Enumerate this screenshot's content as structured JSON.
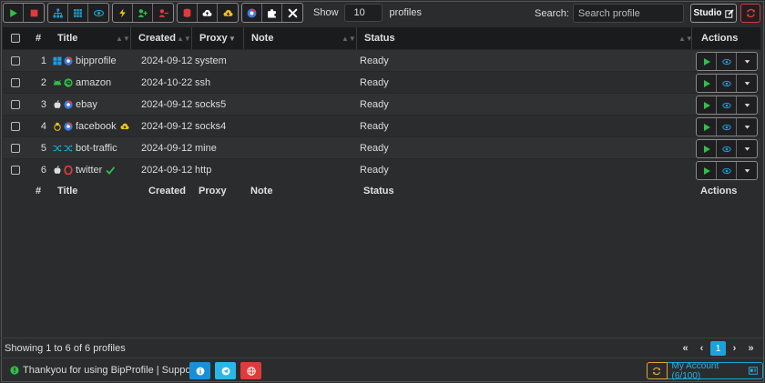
{
  "toolbar": {
    "groups": [
      [
        {
          "icon": "play-icon",
          "color": "#2fbf4a"
        },
        {
          "icon": "stop-icon",
          "color": "#e03a3a"
        }
      ],
      [
        {
          "icon": "sitemap-icon",
          "color": "#1aa3d9"
        },
        {
          "icon": "grid-icon",
          "color": "#1aa3d9"
        },
        {
          "icon": "eye-icon",
          "color": "#1aa3d9"
        }
      ],
      [
        {
          "icon": "bolt-icon",
          "color": "#f0c419"
        },
        {
          "icon": "user-plus-icon",
          "color": "#2fbf4a"
        },
        {
          "icon": "user-minus-icon",
          "color": "#e03a3a"
        }
      ],
      [
        {
          "icon": "database-icon",
          "color": "#e03a3a"
        },
        {
          "icon": "cloud-upload-icon",
          "color": "#ffffff"
        },
        {
          "icon": "cloud-download-icon",
          "color": "#f0c419"
        }
      ],
      [
        {
          "icon": "chrome-icon",
          "color": "#3a7be0"
        },
        {
          "icon": "puzzle-icon",
          "color": "#ffffff"
        },
        {
          "icon": "tools-icon",
          "color": "#ffffff"
        }
      ]
    ],
    "show_label": "Show",
    "show_value": "10",
    "profiles_label": "profiles",
    "search_label": "Search:",
    "search_placeholder": "Search profile",
    "studio_label": "Studio"
  },
  "table": {
    "headers": {
      "num": "#",
      "title": "Title",
      "created": "Created",
      "proxy": "Proxy",
      "note": "Note",
      "status": "Status",
      "actions": "Actions"
    },
    "rows": [
      {
        "num": "1",
        "title": "bipprofile",
        "created": "2024-09-12",
        "proxy": "system",
        "note": "",
        "status": "Ready",
        "os_icon": "windows-icon",
        "browser_icon": "chrome-icon",
        "extra_icon": ""
      },
      {
        "num": "2",
        "title": "amazon",
        "created": "2024-10-22",
        "proxy": "ssh",
        "note": "",
        "status": "Ready",
        "os_icon": "android-icon",
        "browser_icon": "edge-icon",
        "extra_icon": ""
      },
      {
        "num": "3",
        "title": "ebay",
        "created": "2024-09-12",
        "proxy": "socks5",
        "note": "",
        "status": "Ready",
        "os_icon": "apple-icon",
        "browser_icon": "chrome-icon",
        "extra_icon": ""
      },
      {
        "num": "4",
        "title": "facebook",
        "created": "2024-09-12",
        "proxy": "socks4",
        "note": "",
        "status": "Ready",
        "os_icon": "linux-icon",
        "browser_icon": "chrome-icon",
        "extra_icon": "cloud-download-icon"
      },
      {
        "num": "5",
        "title": "bot-traffic",
        "created": "2024-09-12",
        "proxy": "mine",
        "note": "",
        "status": "Ready",
        "os_icon": "random-icon",
        "browser_icon": "random-icon",
        "extra_icon": ""
      },
      {
        "num": "6",
        "title": "twitter",
        "created": "2024-09-12",
        "proxy": "http",
        "note": "",
        "status": "Ready",
        "os_icon": "apple-icon",
        "browser_icon": "opera-icon",
        "extra_icon": "check-icon"
      }
    ]
  },
  "info": {
    "showing": "Showing 1 to 6 of 6 profiles",
    "pager": {
      "first": "«",
      "prev": "‹",
      "current": "1",
      "next": "›",
      "last": "»"
    }
  },
  "footer": {
    "thanks": "Thankyou for using BipProfile | Support",
    "account_label": "My Account (6/100)"
  },
  "colors": {
    "green": "#2fbf4a",
    "red": "#e03a3a",
    "blue": "#1aa3d9",
    "yellow": "#f0c419"
  }
}
